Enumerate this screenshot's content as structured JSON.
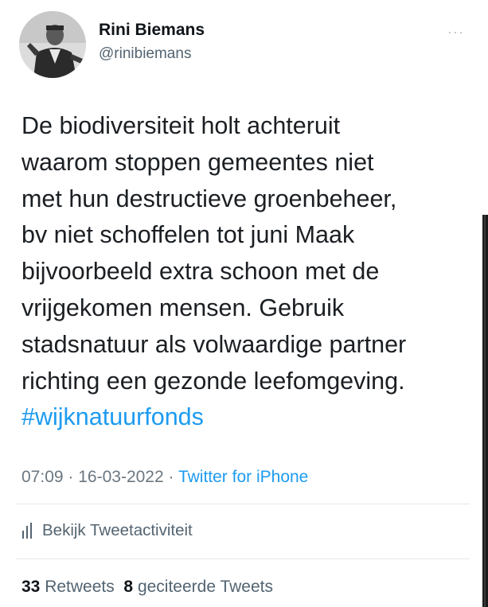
{
  "author": {
    "name": "Rini Biemans",
    "handle": "@rinibiemans"
  },
  "menu": {
    "more": "···"
  },
  "tweet": {
    "text": "De biodiversiteit holt achteruit\nwaarom stoppen gemeentes niet\nmet hun destructieve groenbeheer,\nbv niet schoffelen tot juni Maak\nbijvoorbeeld extra schoon met de\nvrijgekomen mensen. Gebruik\nstadsnatuur als volwaardige partner\nrichting een gezonde leefomgeving.",
    "hashtag": "#wijknatuurfonds"
  },
  "meta": {
    "time": "07:09",
    "separator": " · ",
    "date": "16-03-2022",
    "source": "Twitter for iPhone"
  },
  "activity": {
    "label": "Bekijk Tweetactiviteit"
  },
  "stats": {
    "retweets_count": "33",
    "retweets_label": "Retweets",
    "quotes_count": "8",
    "quotes_label": "geciteerde Tweets"
  },
  "colors": {
    "link": "#1d9bf0",
    "secondary_text": "#536471"
  }
}
